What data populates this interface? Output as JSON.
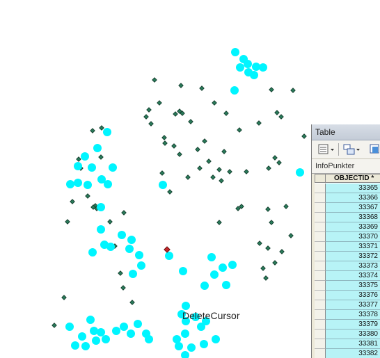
{
  "map": {
    "cursor_label": "DeleteCursor",
    "colors": {
      "selected": "#00f5ff",
      "point_fill": "#2a7a5a",
      "point_stroke": "#123a2a",
      "highlight": "#c0282a"
    }
  },
  "table": {
    "window_title": "Table",
    "tab_label": "InfoPunkter",
    "column_header": "OBJECTID *",
    "rows": [
      "33365",
      "33366",
      "33367",
      "33368",
      "33369",
      "33370",
      "33371",
      "33372",
      "33373",
      "33374",
      "33375",
      "33376",
      "33377",
      "33378",
      "33379",
      "33380",
      "33381",
      "33382"
    ],
    "toolbar_icons": [
      "table-options-icon",
      "related-tables-icon",
      "select-by-attributes-icon"
    ],
    "selected_row_color": "#b7f3f6"
  }
}
